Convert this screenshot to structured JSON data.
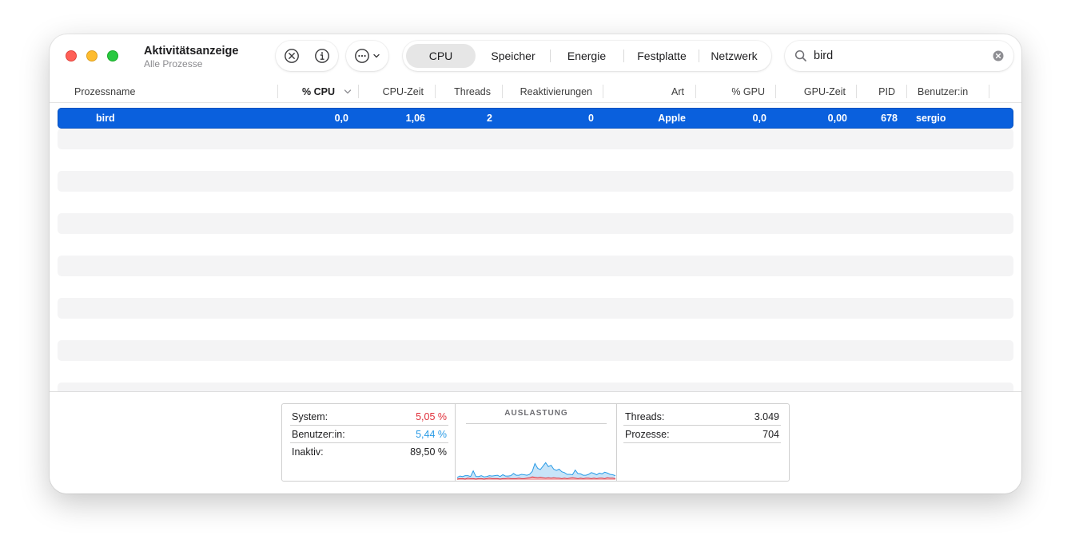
{
  "window": {
    "title": "Aktivitätsanzeige",
    "subtitle": "Alle Prozesse"
  },
  "toolbar": {
    "stop_icon": "xmark-circle-icon",
    "info_icon": "info-circle-icon",
    "more_icon": "ellipsis-circle-icon",
    "tabs": [
      {
        "label": "CPU",
        "active": true
      },
      {
        "label": "Speicher",
        "active": false
      },
      {
        "label": "Energie",
        "active": false
      },
      {
        "label": "Festplatte",
        "active": false
      },
      {
        "label": "Netzwerk",
        "active": false
      }
    ]
  },
  "search": {
    "value": "bird",
    "placeholder": ""
  },
  "table": {
    "columns": [
      "Prozessname",
      "% CPU",
      "CPU-Zeit",
      "Threads",
      "Reaktivierungen",
      "Art",
      "% GPU",
      "GPU-Zeit",
      "PID",
      "Benutzer:in"
    ],
    "sort_column": "% CPU",
    "sort_direction": "descending",
    "rows": [
      {
        "name": "bird",
        "cpu": "0,0",
        "cpu_time": "1,06",
        "threads": "2",
        "wakeups": "0",
        "kind": "Apple",
        "gpu": "0,0",
        "gpu_time": "0,00",
        "pid": "678",
        "user": "sergio"
      }
    ]
  },
  "stats": {
    "system_label": "System:",
    "system_value": "5,05 %",
    "user_label": "Benutzer:in:",
    "user_value": "5,44 %",
    "idle_label": "Inaktiv:",
    "idle_value": "89,50 %",
    "chart_title": "AUSLASTUNG",
    "threads_label": "Threads:",
    "threads_value": "3.049",
    "processes_label": "Prozesse:",
    "processes_value": "704"
  },
  "colors": {
    "selection": "#0a60dd",
    "system": "#e0303a",
    "user": "#2a9be6"
  },
  "chart_data": {
    "type": "area",
    "title": "AUSLASTUNG",
    "xlabel": "",
    "ylabel": "",
    "ylim": [
      0,
      100
    ],
    "grid": false,
    "series": [
      {
        "name": "System",
        "color": "#e0303a",
        "values": [
          2,
          3,
          3,
          2,
          4,
          3,
          3,
          2,
          3,
          3,
          2,
          3,
          4,
          3,
          3,
          3,
          2,
          3,
          3,
          4,
          3,
          3,
          3,
          4,
          3,
          3,
          4,
          5,
          7,
          6,
          5,
          6,
          5,
          4,
          5,
          4,
          5,
          4,
          4,
          3,
          4,
          3,
          4,
          5,
          4,
          3,
          4,
          3,
          4,
          4,
          3,
          4,
          3,
          4,
          4,
          3,
          5,
          4,
          4,
          3
        ]
      },
      {
        "name": "Benutzer:in",
        "color": "#2a9be6",
        "values": [
          4,
          6,
          5,
          8,
          6,
          5,
          18,
          6,
          5,
          7,
          5,
          5,
          6,
          6,
          7,
          8,
          6,
          9,
          6,
          5,
          7,
          12,
          8,
          7,
          10,
          9,
          7,
          8,
          13,
          32,
          22,
          18,
          27,
          36,
          26,
          30,
          20,
          18,
          21,
          16,
          13,
          10,
          9,
          7,
          19,
          12,
          10,
          8,
          7,
          9,
          14,
          11,
          9,
          12,
          10,
          15,
          11,
          9,
          8,
          7
        ]
      }
    ]
  }
}
